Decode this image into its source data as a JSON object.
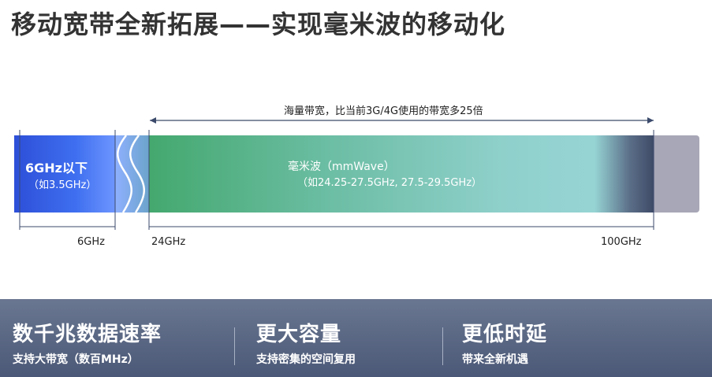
{
  "title": "移动宽带全新拓展——实现毫米波的移动化",
  "spectrum": {
    "top_caption": "海量带宽，比当前3G/4G使用的带宽多25倍",
    "low_band_label": "6GHz以下",
    "low_band_sub": "（如3.5GHz）",
    "mmwave_label": "毫米波（mmWave）",
    "mmwave_sub": "（如24.25-27.5GHz, 27.5-29.5GHz）",
    "tick_6": "6GHz",
    "tick_24": "24GHz",
    "tick_100": "100GHz"
  },
  "features": [
    {
      "title": "数千兆数据速率",
      "subtitle": "支持大带宽（数百MHz）"
    },
    {
      "title": "更大容量",
      "subtitle": "支持密集的空间复用"
    },
    {
      "title": "更低时延",
      "subtitle": "带来全新机遇"
    }
  ],
  "colors": {
    "low_band": "#3f6ff0",
    "mmwave_band": "#8fd0cb",
    "high_band": "#a7a7b7",
    "footer": "#4b5877"
  }
}
